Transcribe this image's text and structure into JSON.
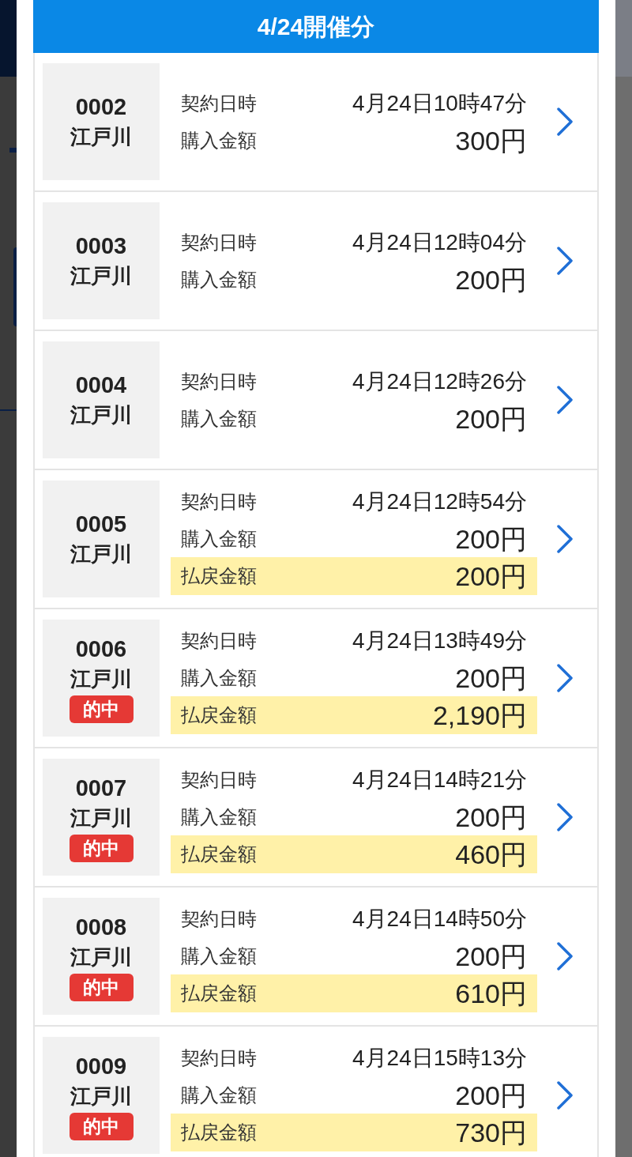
{
  "header": {
    "title": "4/24開催分"
  },
  "tickets": [
    {
      "number": "0002",
      "venue": "江戸川",
      "rows": [
        {
          "kind": "datetime",
          "label": "契約日時",
          "value": "4月24日10時47分"
        },
        {
          "kind": "amount",
          "label": "購入金額",
          "value": "300円"
        }
      ]
    },
    {
      "number": "0003",
      "venue": "江戸川",
      "rows": [
        {
          "kind": "datetime",
          "label": "契約日時",
          "value": "4月24日12時04分"
        },
        {
          "kind": "amount",
          "label": "購入金額",
          "value": "200円"
        }
      ]
    },
    {
      "number": "0004",
      "venue": "江戸川",
      "rows": [
        {
          "kind": "datetime",
          "label": "契約日時",
          "value": "4月24日12時26分"
        },
        {
          "kind": "amount",
          "label": "購入金額",
          "value": "200円"
        }
      ]
    },
    {
      "number": "0005",
      "venue": "江戸川",
      "rows": [
        {
          "kind": "datetime",
          "label": "契約日時",
          "value": "4月24日12時54分"
        },
        {
          "kind": "amount",
          "label": "購入金額",
          "value": "200円"
        },
        {
          "kind": "payout",
          "label": "払戻金額",
          "value": "200円"
        }
      ]
    },
    {
      "number": "0006",
      "venue": "江戸川",
      "badge": "的中",
      "rows": [
        {
          "kind": "datetime",
          "label": "契約日時",
          "value": "4月24日13時49分"
        },
        {
          "kind": "amount",
          "label": "購入金額",
          "value": "200円"
        },
        {
          "kind": "payout",
          "label": "払戻金額",
          "value": "2,190円"
        }
      ]
    },
    {
      "number": "0007",
      "venue": "江戸川",
      "badge": "的中",
      "rows": [
        {
          "kind": "datetime",
          "label": "契約日時",
          "value": "4月24日14時21分"
        },
        {
          "kind": "amount",
          "label": "購入金額",
          "value": "200円"
        },
        {
          "kind": "payout",
          "label": "払戻金額",
          "value": "460円"
        }
      ]
    },
    {
      "number": "0008",
      "venue": "江戸川",
      "badge": "的中",
      "rows": [
        {
          "kind": "datetime",
          "label": "契約日時",
          "value": "4月24日14時50分"
        },
        {
          "kind": "amount",
          "label": "購入金額",
          "value": "200円"
        },
        {
          "kind": "payout",
          "label": "払戻金額",
          "value": "610円"
        }
      ]
    },
    {
      "number": "0009",
      "venue": "江戸川",
      "badge": "的中",
      "rows": [
        {
          "kind": "datetime",
          "label": "契約日時",
          "value": "4月24日15時13分"
        },
        {
          "kind": "amount",
          "label": "購入金額",
          "value": "200円"
        },
        {
          "kind": "payout",
          "label": "払戻金額",
          "value": "730円"
        }
      ]
    }
  ]
}
